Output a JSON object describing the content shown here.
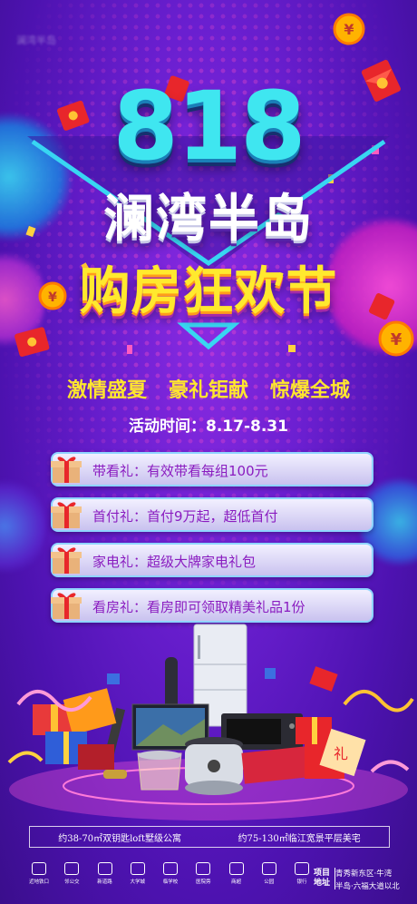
{
  "logo": "澜湾半岛",
  "headline": {
    "number": "818",
    "title": "澜湾半岛",
    "subtitle": "购房狂欢节"
  },
  "slogans": [
    "激情盛夏",
    "豪礼钜献",
    "惊爆全城"
  ],
  "event_time": "活动时间：8.17-8.31",
  "gift_bars": [
    {
      "label": "带看礼：有效带看每组100元"
    },
    {
      "label": "首付礼：首付9万起，超低首付"
    },
    {
      "label": "家电礼：超级大牌家电礼包"
    },
    {
      "label": "看房礼：看房即可领取精美礼品1份"
    }
  ],
  "footer": {
    "left": "约38-70㎡双钥匙loft墅级公寓",
    "right": "约75-130㎡临江宽景平层美宅"
  },
  "amenity_icons": [
    {
      "icon": "subway-icon",
      "label": "近地铁口"
    },
    {
      "icon": "bus-icon",
      "label": "邻公交"
    },
    {
      "icon": "road-icon",
      "label": "新道路"
    },
    {
      "icon": "university-icon",
      "label": "大学城"
    },
    {
      "icon": "school-icon",
      "label": "临学校"
    },
    {
      "icon": "hospital-icon",
      "label": "医院旁"
    },
    {
      "icon": "mall-icon",
      "label": "商超"
    },
    {
      "icon": "park-icon",
      "label": "公园"
    },
    {
      "icon": "bank-icon",
      "label": "银行"
    }
  ],
  "project_address": {
    "label": "项目地址",
    "line1": "青秀新东区·牛湾",
    "line2": "半岛·六福大道以北"
  },
  "colors": {
    "accent_cyan": "#3fe6f0",
    "accent_yellow": "#ffe92e",
    "bg_purple": "#6a1fd0",
    "bar_text": "#8a1cc0"
  }
}
